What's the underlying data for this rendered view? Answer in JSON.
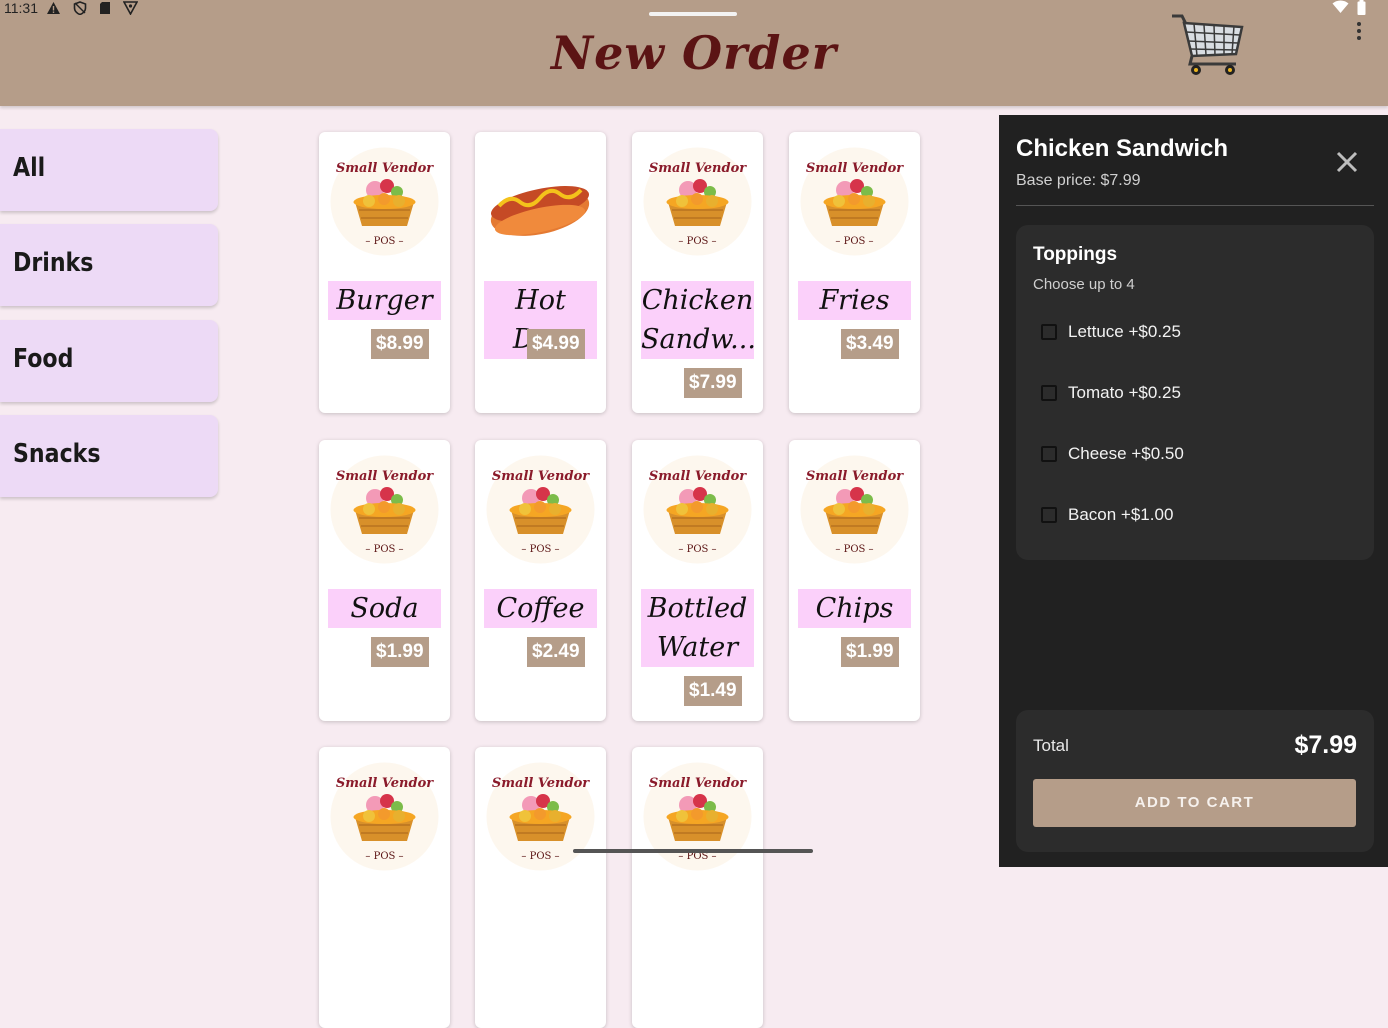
{
  "status_bar": {
    "time": "11:31"
  },
  "header": {
    "title": "New Order"
  },
  "categories": [
    {
      "label": "All"
    },
    {
      "label": "Drinks"
    },
    {
      "label": "Food"
    },
    {
      "label": "Snacks"
    }
  ],
  "products": [
    {
      "name": "Burger",
      "price": "$8.99",
      "image": "logo"
    },
    {
      "name": "Hot Dog",
      "price": "$4.99",
      "image": "hotdog"
    },
    {
      "name": "Chicken Sandw...",
      "price": "$7.99",
      "image": "logo"
    },
    {
      "name": "Fries",
      "price": "$3.49",
      "image": "logo"
    },
    {
      "name": "Soda",
      "price": "$1.99",
      "image": "logo"
    },
    {
      "name": "Coffee",
      "price": "$2.49",
      "image": "logo"
    },
    {
      "name": "Bottled Water",
      "price": "$1.49",
      "image": "logo"
    },
    {
      "name": "Chips",
      "price": "$1.99",
      "image": "logo"
    },
    {
      "name": "",
      "price": "",
      "image": "logo"
    },
    {
      "name": "",
      "price": "",
      "image": "logo"
    },
    {
      "name": "",
      "price": "",
      "image": "logo"
    }
  ],
  "logo_text": {
    "line1": "Small Vendor",
    "line2": "POS"
  },
  "panel": {
    "title": "Chicken Sandwich",
    "base_price": "Base price: $7.99",
    "toppings": {
      "heading": "Toppings",
      "subtitle": "Choose up to 4",
      "options": [
        {
          "label": "Lettuce  +$0.25",
          "checked": false
        },
        {
          "label": "Tomato  +$0.25",
          "checked": false
        },
        {
          "label": "Cheese  +$0.50",
          "checked": false
        },
        {
          "label": "Bacon  +$1.00",
          "checked": false
        }
      ]
    },
    "total_label": "Total",
    "total_value": "$7.99",
    "add_button": "ADD TO CART"
  },
  "colors": {
    "header": "#b59d89",
    "background": "#f7ebf1",
    "category": "#eddaf6",
    "name_highlight": "#fbd0fa",
    "price_tag": "#b59d89",
    "panel": "#212121",
    "title": "#5b1414"
  }
}
